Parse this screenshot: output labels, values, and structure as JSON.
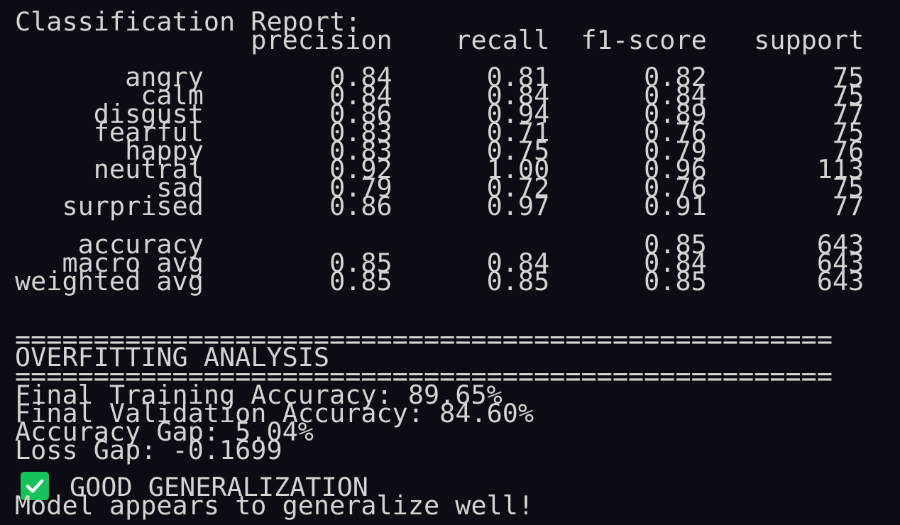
{
  "report": {
    "title": "Classification Report:",
    "columns": [
      "precision",
      "recall",
      "f1-score",
      "support"
    ],
    "rows": [
      {
        "label": "angry",
        "precision": "0.84",
        "recall": "0.81",
        "f1": "0.82",
        "support": "75"
      },
      {
        "label": "calm",
        "precision": "0.84",
        "recall": "0.84",
        "f1": "0.84",
        "support": "75"
      },
      {
        "label": "disgust",
        "precision": "0.86",
        "recall": "0.94",
        "f1": "0.89",
        "support": "77"
      },
      {
        "label": "fearful",
        "precision": "0.83",
        "recall": "0.71",
        "f1": "0.76",
        "support": "75"
      },
      {
        "label": "happy",
        "precision": "0.83",
        "recall": "0.75",
        "f1": "0.79",
        "support": "76"
      },
      {
        "label": "neutral",
        "precision": "0.92",
        "recall": "1.00",
        "f1": "0.96",
        "support": "113"
      },
      {
        "label": "sad",
        "precision": "0.79",
        "recall": "0.72",
        "f1": "0.76",
        "support": "75"
      },
      {
        "label": "surprised",
        "precision": "0.86",
        "recall": "0.97",
        "f1": "0.91",
        "support": "77"
      }
    ],
    "summary": [
      {
        "label": "accuracy",
        "precision": "",
        "recall": "",
        "f1": "0.85",
        "support": "643"
      },
      {
        "label": "macro avg",
        "precision": "0.85",
        "recall": "0.84",
        "f1": "0.84",
        "support": "643"
      },
      {
        "label": "weighted avg",
        "precision": "0.85",
        "recall": "0.85",
        "f1": "0.85",
        "support": "643"
      }
    ]
  },
  "analysis": {
    "separator": "====================================================",
    "title": "OVERFITTING ANALYSIS",
    "lines": [
      "Final Training Accuracy: 89.65%",
      "Final Validation Accuracy: 84.60%",
      "Accuracy Gap: 5.04%",
      "Loss Gap: -0.1699"
    ],
    "status_icon": "check-mark-icon",
    "status_color": "#16c25a",
    "status_text": "GOOD GENERALIZATION",
    "conclusion": "Model appears to generalize well!"
  }
}
